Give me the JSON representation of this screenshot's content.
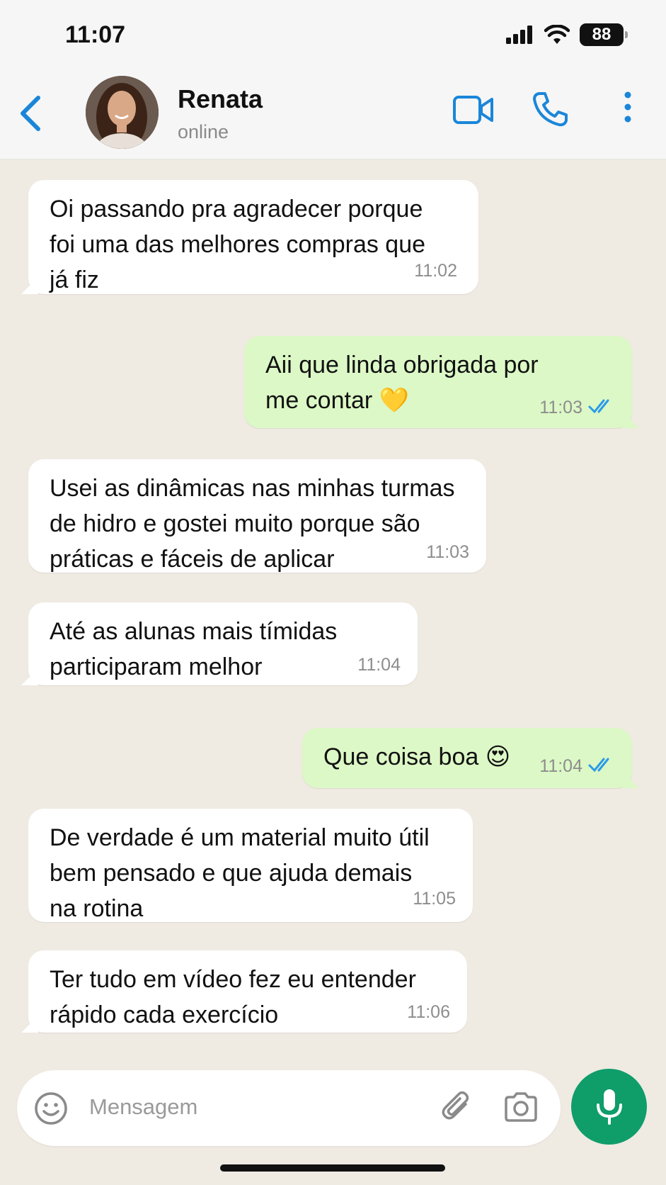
{
  "status_bar": {
    "time": "11:07",
    "battery": "88"
  },
  "header": {
    "contact_name": "Renata",
    "contact_status": "online"
  },
  "messages": [
    {
      "direction": "incoming",
      "text_lines": [
        "Oi passando pra agradecer porque",
        "foi uma das melhores compras que",
        "já fiz"
      ],
      "time": "11:02"
    },
    {
      "direction": "outgoing",
      "text_lines": [
        "Aii que linda obrigada por",
        "me contar 💛"
      ],
      "time": "11:03",
      "status": "read"
    },
    {
      "direction": "incoming",
      "text_lines": [
        "Usei as dinâmicas nas minhas turmas",
        "de hidro e gostei muito porque são",
        "práticas e fáceis de aplicar"
      ],
      "time": "11:03"
    },
    {
      "direction": "incoming",
      "text_lines": [
        "Até as alunas mais tímidas",
        "participaram melhor"
      ],
      "time": "11:04"
    },
    {
      "direction": "outgoing",
      "text_lines": [
        "Que coisa boa 😍"
      ],
      "time": "11:04",
      "status": "read"
    },
    {
      "direction": "incoming",
      "text_lines": [
        "De verdade é um material muito útil",
        "bem pensado e que ajuda demais",
        "na rotina"
      ],
      "time": "11:05"
    },
    {
      "direction": "incoming",
      "text_lines": [
        "Ter tudo em vídeo fez eu entender",
        "rápido cada exercício"
      ],
      "time": "11:06"
    }
  ],
  "composer": {
    "placeholder": "Mensagem"
  },
  "colors": {
    "accent_blue": "#1a86d9",
    "outgoing_bubble": "#dcf8c6",
    "mic_button": "#0f9d6a",
    "chat_background": "#efeae2"
  },
  "icons": [
    "back-chevron-icon",
    "video-call-icon",
    "phone-icon",
    "more-vertical-icon",
    "emoji-icon",
    "attachment-icon",
    "camera-icon",
    "microphone-icon",
    "double-check-icon"
  ]
}
